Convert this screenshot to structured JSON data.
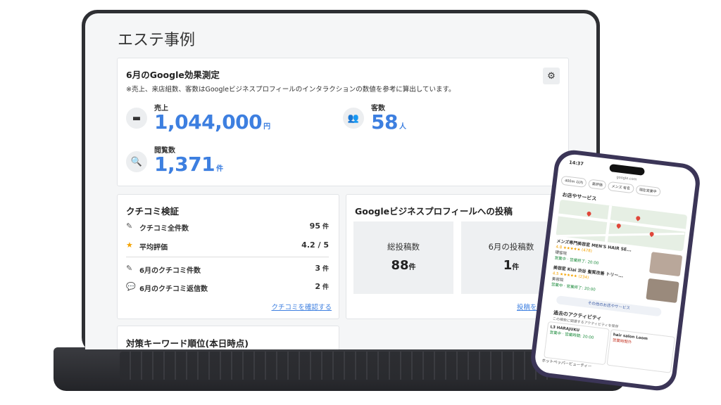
{
  "page": {
    "title": "エステ事例"
  },
  "effect": {
    "title": "6月のGoogle効果測定",
    "note": "※売上、来店組数、客数はGoogleビジネスプロフィールのインタラクションの数値を参考に算出しています。",
    "sales": {
      "label": "売上",
      "value": "1,044,000",
      "unit": "円"
    },
    "customers": {
      "label": "客数",
      "value": "58",
      "unit": "人"
    },
    "views": {
      "label": "閲覧数",
      "value": "1,371",
      "unit": "件"
    }
  },
  "reviews": {
    "title": "クチコミ検証",
    "rows": [
      {
        "label": "クチコミ全件数",
        "value": "95",
        "unit": "件"
      },
      {
        "label": "平均評価",
        "value": "4.2 / 5",
        "unit": ""
      },
      {
        "label": "6月のクチコミ件数",
        "value": "3",
        "unit": "件"
      },
      {
        "label": "6月のクチコミ返信数",
        "value": "2",
        "unit": "件"
      }
    ],
    "link": "クチコミを確認する"
  },
  "posts": {
    "title": "Googleビジネスプロフィールへの投稿",
    "total": {
      "label": "総投稿数",
      "value": "88",
      "unit": "件"
    },
    "month": {
      "label": "6月の投稿数",
      "value": "1",
      "unit": "件"
    },
    "link": "投稿を確認"
  },
  "keywords": {
    "title": "対策キーワード順位(本日時点)"
  },
  "phone": {
    "time": "14:37",
    "url": "google.com",
    "chips": [
      "400m 以内",
      "高評価",
      "メンズ 有名",
      "現在営業中"
    ],
    "section": "お店やサービス",
    "businesses": [
      {
        "name": "メンズ専門美容室 MEN'S HAIR SE...",
        "rating": "4.8 ★★★★★ (478)",
        "type": "理容院",
        "hours": "営業中 · 営業終了: 20:00"
      },
      {
        "name": "美容室 Kiai 渋谷 髪質改善 トリー...",
        "rating": "4.5 ★★★★★ (234)",
        "type": "美容院",
        "hours": "営業中 · 営業終了: 20:00"
      }
    ],
    "more": "その他のお店やサービス",
    "activity_title": "過去のアクティビティ",
    "activity_sub": "この検索に関連するアクティビティを保存",
    "activity_cards": [
      {
        "name": "L3 HARAJUKU",
        "info": "営業中 · 営業時間: 20:00"
      },
      {
        "name": "hair salon Loom",
        "info": "営業時間外"
      }
    ],
    "bottom": "ホットペッパービューティー"
  },
  "colors": {
    "accent": "#3d7fe0",
    "star": "#f4a300",
    "phone_frame": "#3b3557"
  }
}
